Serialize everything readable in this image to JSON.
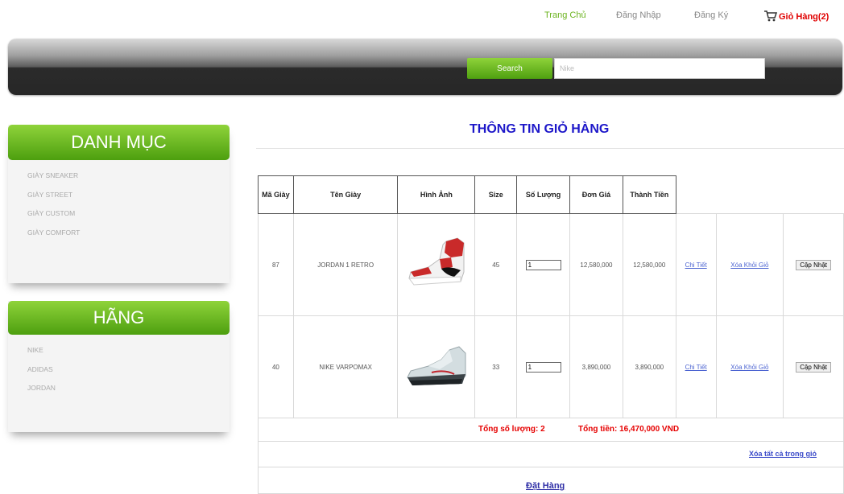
{
  "nav": {
    "home": "Trang Chủ",
    "login": "Đăng Nhập",
    "register": "Đăng Ký",
    "cart": "Giỏ Hàng(2)"
  },
  "search": {
    "button": "Search",
    "placeholder": "Nike"
  },
  "sidebar": {
    "categories_title": "DANH MỤC",
    "categories": [
      "GIÀY SNEAKER",
      "GIÀY STREET",
      "GIÀY CUSTOM",
      "GIÀY COMFORT"
    ],
    "brands_title": "HÃNG",
    "brands": [
      "NIKE",
      "ADIDAS",
      "JORDAN"
    ]
  },
  "main": {
    "title": "THÔNG TIN GIỎ HÀNG",
    "headers": {
      "id": "Mã Giày",
      "name": "Tên Giày",
      "image": "Hình Ảnh",
      "size": "Size",
      "qty": "Số Lượng",
      "unit_price": "Đơn Giá",
      "subtotal": "Thành Tiền"
    },
    "rows": [
      {
        "id": "87",
        "name": "JORDAN 1 RETRO",
        "size": "45",
        "qty": "1",
        "unit_price": "12,580,000",
        "subtotal": "12,580,000",
        "detail": "Chi Tiết",
        "remove": "Xóa Khỏi Giỏ",
        "update": "Cập Nhật",
        "image_icon": "red-sneaker"
      },
      {
        "id": "40",
        "name": "NIKE VARPOMAX",
        "size": "33",
        "qty": "1",
        "unit_price": "3,890,000",
        "subtotal": "3,890,000",
        "detail": "Chi Tiết",
        "remove": "Xóa Khỏi Giỏ",
        "update": "Cập Nhật",
        "image_icon": "grey-sneaker"
      }
    ],
    "total_qty": "Tổng số lượng: 2",
    "total_price": "Tổng tiền: 16,470,000 VND",
    "clear_all": "Xóa tất cả trong giỏ",
    "checkout": "Đặt Hàng"
  },
  "colors": {
    "accent_green": "#6bb31e",
    "title_blue": "#1d17c9",
    "alert_red": "#e60000"
  }
}
